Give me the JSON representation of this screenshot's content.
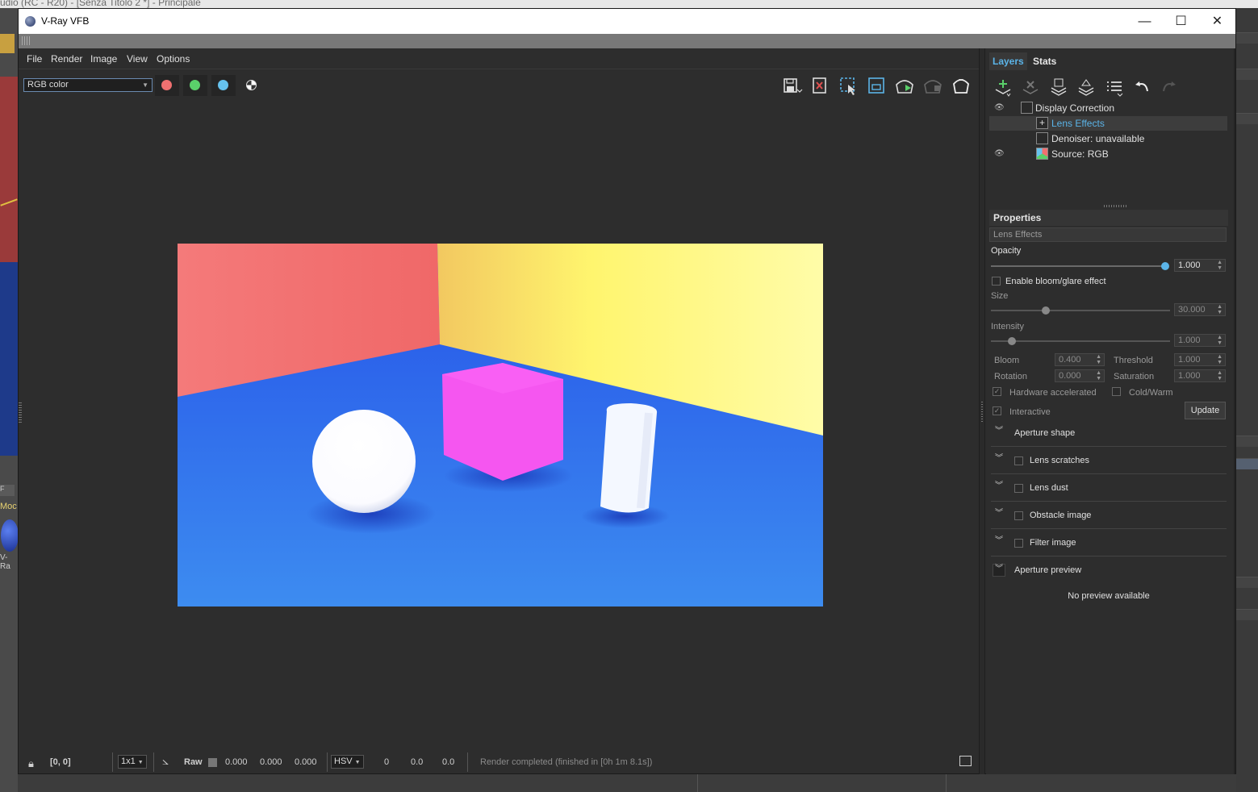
{
  "host": {
    "top_text": "udio (RC - R20) - [Senza Titolo 2 *] - Principale",
    "mod_label": "Moc",
    "vr_label": "V-Ra",
    "f_label": "F"
  },
  "window": {
    "title": "V-Ray VFB",
    "minimize": "—",
    "maximize": "☐",
    "close": "✕"
  },
  "menu": {
    "file": "File",
    "render": "Render",
    "image": "Image",
    "view": "View",
    "options": "Options"
  },
  "toolbar": {
    "channel_select": "RGB color",
    "channel_colors": {
      "red": "#f07070",
      "green": "#5ad06a",
      "blue": "#66c2ee"
    },
    "icons": [
      "save-image-icon",
      "clear-image-icon",
      "region-render-icon",
      "lens-compare-icon",
      "render-icon",
      "stop-render-icon",
      "teapot-icon"
    ]
  },
  "render": {
    "colors": {
      "left_wall": "#f47474",
      "right_wall": "#fff59a",
      "floor": "#3566f0",
      "cube": "#f556f0",
      "sphere": "#ffffff",
      "cylinder": "#f4f8ff"
    }
  },
  "status": {
    "coords": "[0, 0]",
    "zoom": "1x1",
    "raw": "Raw",
    "r": "0.000",
    "g": "0.000",
    "b": "0.000",
    "color_mode": "HSV",
    "h": "0",
    "s": "0.0",
    "v": "0.0",
    "message": "Render completed (finished in [0h  1m  8.1s])"
  },
  "panel": {
    "tabs": {
      "layers": "Layers",
      "stats": "Stats"
    },
    "layer_tools": [
      "add-layer-icon",
      "delete-layer-icon",
      "save-layers-icon",
      "load-layers-icon",
      "layer-list-icon",
      "undo-icon",
      "redo-icon"
    ],
    "layers": {
      "display_correction": "Display Correction",
      "lens_effects": "Lens Effects",
      "denoiser": "Denoiser: unavailable",
      "source": "Source: RGB"
    },
    "properties": {
      "header": "Properties",
      "name": "Lens Effects",
      "opacity_label": "Opacity",
      "opacity": "1.000",
      "opacity_level": 1.0,
      "enable_bloom": "Enable bloom/glare effect",
      "size_label": "Size",
      "size": "30.000",
      "intensity_label": "Intensity",
      "intensity": "1.000",
      "bloom_label": "Bloom",
      "bloom": "0.400",
      "threshold_label": "Threshold",
      "threshold": "1.000",
      "rotation_label": "Rotation",
      "rotation": "0.000",
      "saturation_label": "Saturation",
      "saturation": "1.000",
      "hardware": "Hardware accelerated",
      "coldwarm": "Cold/Warm",
      "interactive": "Interactive",
      "update": "Update",
      "sections": {
        "aperture_shape": "Aperture shape",
        "lens_scratches": "Lens scratches",
        "lens_dust": "Lens dust",
        "obstacle_image": "Obstacle image",
        "filter_image": "Filter image",
        "aperture_preview": "Aperture preview"
      },
      "no_preview": "No preview available"
    }
  }
}
